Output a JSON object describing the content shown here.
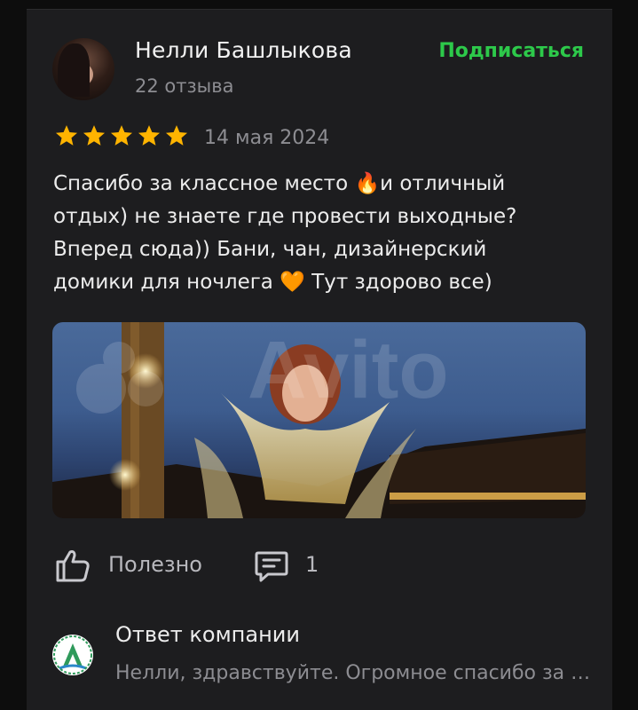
{
  "review": {
    "author_name": "Нелли Башлыкова",
    "author_reviews": "22 отзыва",
    "subscribe_label": "Подписаться",
    "rating": 5,
    "rating_max": 5,
    "date": "14 мая 2024",
    "text": "Спасибо за классное место 🔥и отличный\nотдых) не знаете где провести выходные?\nВперед сюда)) Бани, чан, дизайнерский\nдомики для ночлега 🧡 Тут здорово все)"
  },
  "actions": {
    "helpful_label": "Полезно",
    "comments_count": "1"
  },
  "company_reply": {
    "title": "Ответ компании",
    "text": "Нелли, здравствуйте. Огромное спасибо за отзыв"
  },
  "icons": {
    "star": "star-icon",
    "like": "thumbs-up-icon",
    "comment": "comment-icon"
  },
  "colors": {
    "accent": "#2dc94a",
    "star": "#ffb400",
    "background": "#1d1d1f"
  }
}
